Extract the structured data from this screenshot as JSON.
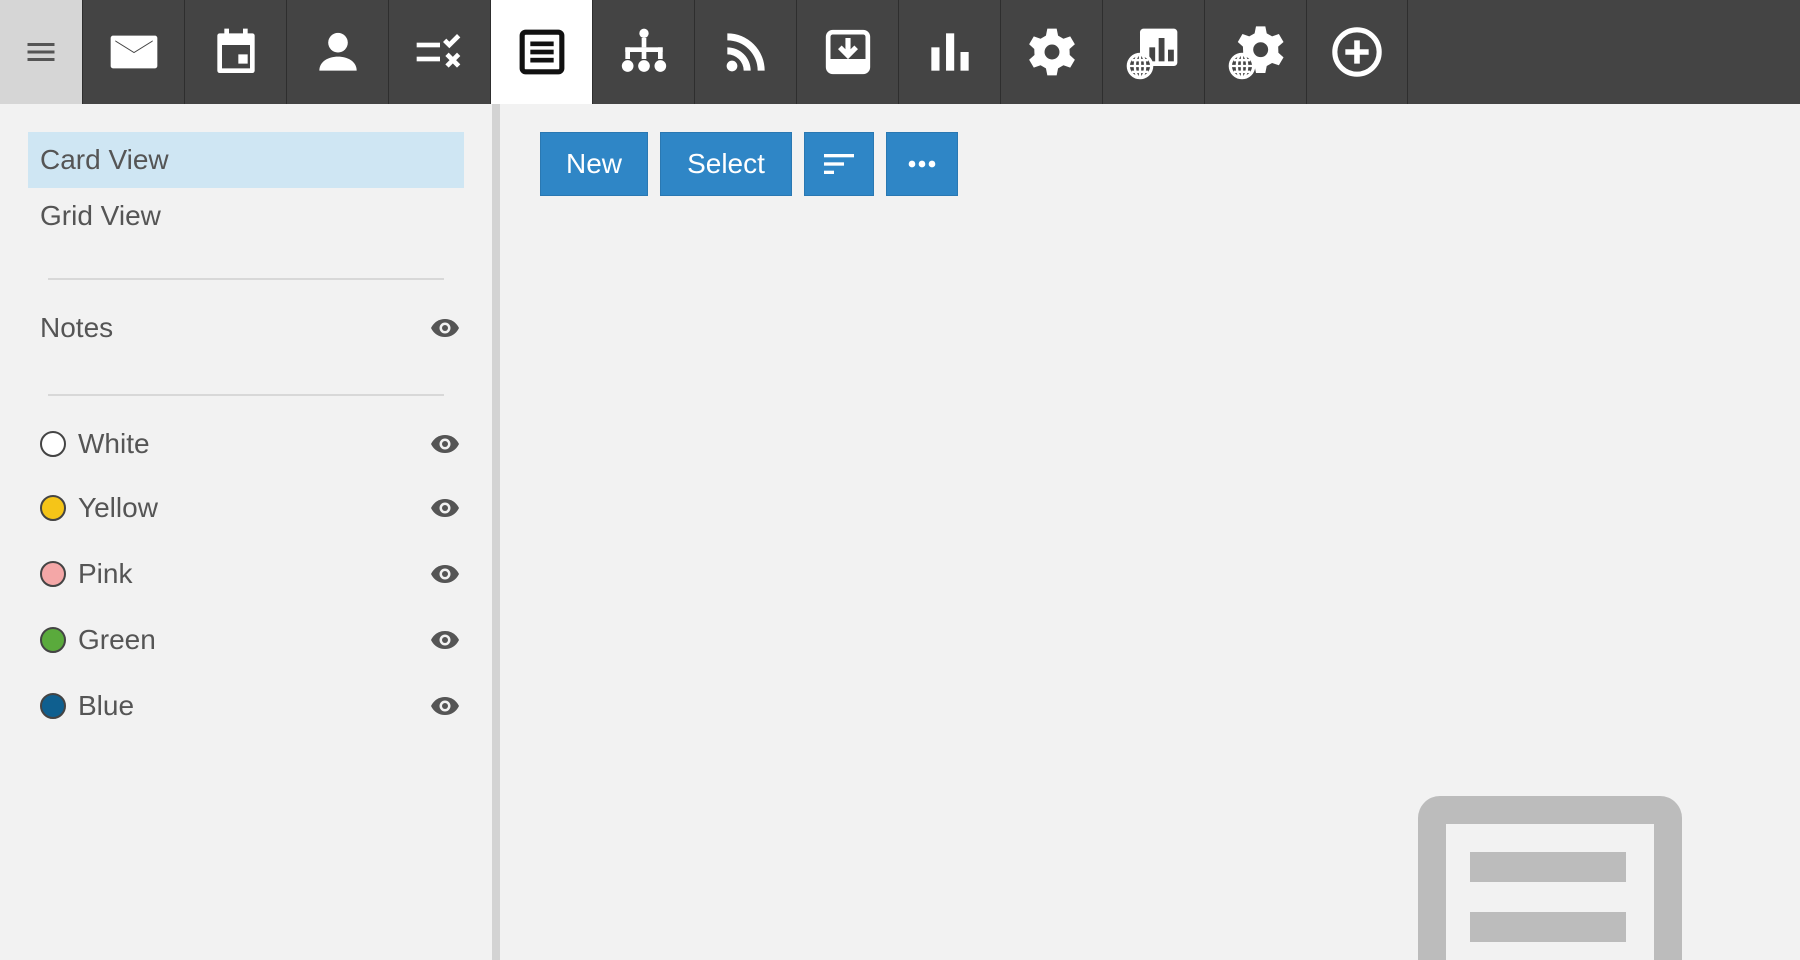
{
  "topbar": {
    "menu_icon": "hamburger-icon",
    "apps": [
      {
        "name": "mail",
        "icon": "mail-icon"
      },
      {
        "name": "calendar",
        "icon": "calendar-icon"
      },
      {
        "name": "contacts",
        "icon": "person-icon"
      },
      {
        "name": "tasks",
        "icon": "tasks-icon"
      },
      {
        "name": "notes",
        "icon": "notes-icon",
        "active": true
      },
      {
        "name": "organization",
        "icon": "org-chart-icon"
      },
      {
        "name": "feeds",
        "icon": "rss-icon"
      },
      {
        "name": "inbox",
        "icon": "inbox-download-icon"
      },
      {
        "name": "reports",
        "icon": "bar-chart-icon"
      },
      {
        "name": "settings",
        "icon": "gear-icon"
      },
      {
        "name": "global-reports",
        "icon": "global-report-icon"
      },
      {
        "name": "global-settings",
        "icon": "global-gear-icon"
      },
      {
        "name": "add",
        "icon": "add-circle-icon"
      }
    ]
  },
  "sidebar": {
    "views": [
      {
        "label": "Card View",
        "selected": true
      },
      {
        "label": "Grid View",
        "selected": false
      }
    ],
    "folder": {
      "label": "Notes",
      "icon": "eye-icon"
    },
    "colors": [
      {
        "label": "White",
        "color": "#ffffff"
      },
      {
        "label": "Yellow",
        "color": "#f5c518"
      },
      {
        "label": "Pink",
        "color": "#f4a7a7"
      },
      {
        "label": "Green",
        "color": "#5aaa3c"
      },
      {
        "label": "Blue",
        "color": "#0f5f8f"
      }
    ]
  },
  "toolbar": {
    "new_label": "New",
    "select_label": "Select",
    "sort_icon": "sort-icon",
    "more_icon": "more-icon"
  },
  "colors": {
    "topbar_bg": "#444444",
    "accent": "#2f86c6",
    "selected_bg": "#cfe6f3"
  }
}
